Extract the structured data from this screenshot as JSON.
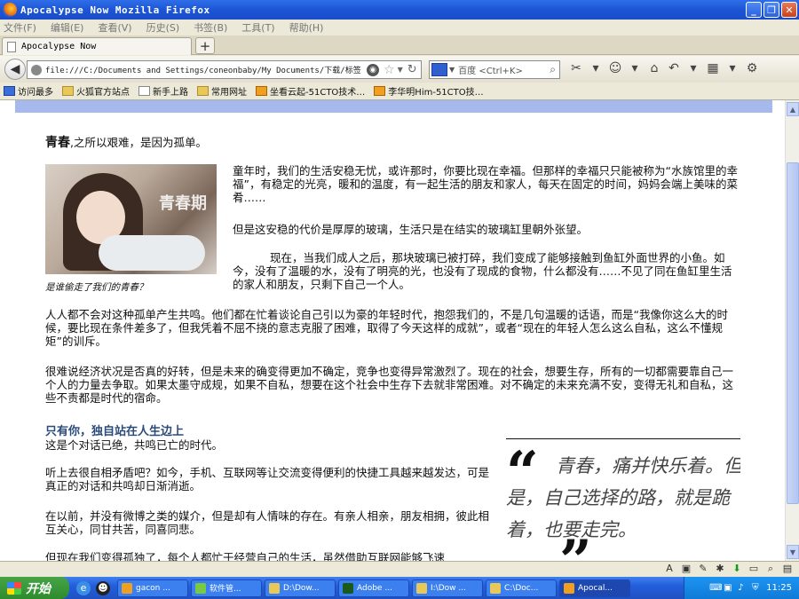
{
  "window": {
    "title": "Apocalypse Now   Mozilla Firefox"
  },
  "menu": [
    "文件(F)",
    "编辑(E)",
    "查看(V)",
    "历史(S)",
    "书签(B)",
    "工具(T)",
    "帮助(H)"
  ],
  "tab": {
    "label": "Apocalypse Now",
    "new_tab": "+"
  },
  "nav": {
    "url": "file:///C:/Documents and Settings/coneonbaby/My Documents/下载/标签",
    "search_placeholder": "百度 <Ctrl+K>"
  },
  "bookmarks": [
    "访问最多",
    "火狐官方站点",
    "新手上路",
    "常用网址",
    "坐看云起-51CTO技术…",
    "李华明Him-51CTO技…"
  ],
  "article": {
    "intro_bold": "青春",
    "intro_rest": ",之所以艰难，是因为孤单。",
    "p1": "童年时，我们的生活安稳无忧，或许那时，你要比现在幸福。但那样的幸福只只能被称为“水族馆里的幸福”，有稳定的光亮，暖和的温度，有一起生活的朋友和家人，每天在固定的时间，妈妈会端上美味的菜肴……",
    "p2": "但是这安稳的代价是厚厚的玻璃，生活只是在结实的玻璃缸里朝外张望。",
    "p3": "现在，当我们成人之后，那块玻璃已被打碎，我们变成了能够接触到鱼缸外面世界的小鱼。如今，没有了温暖的水，没有了明亮的光，也没有了现成的食物，什么都没有……不见了同在鱼缸里生活的家人和朋友，只剩下自己一个人。",
    "image_watermark": "青春期",
    "caption": "是谁偷走了我们的青春？",
    "p4": "人人都不会对这种孤单产生共鸣。他们都在忙着谈论自己引以为豪的年轻时代，抱怨我们的，不是几句温暖的话语，而是“我像你这么大的时候，要比现在条件差多了，但我凭着不屈不挠的意志克服了困难，取得了今天这样的成就”，或者“现在的年轻人怎么这么自私，这么不懂规矩”的训斥。",
    "p5": "很难说经济状况是否真的好转，但是未来的确变得更加不确定，竞争也变得异常激烈了。现在的社会，想要生存，所有的一切都需要靠自己一个人的力量去争取。如果太墨守成规，如果不自私，想要在这个社会中生存下去就非常困难。对不确定的未来充满不安，变得无礼和自私，这些不责都是时代的宿命。",
    "section_title": "只有你，独自站在人生边上",
    "p6": "这是个对话已绝，共鸣已亡的时代。",
    "p7": "听上去很自相矛盾吧？如今，手机、互联网等让交流变得便利的快捷工具越来越发达，可是真正的对话和共鸣却日渐消逝。",
    "p8": "在以前，并没有微博之类的媒介，但是却有人情味的存在。有亲人相亲，朋友相拥，彼此相互关心，同甘共苦，同喜同悲。",
    "p9": "但现在我们变得孤独了，每个人都忙于经营自己的生活，虽然借助互联网能够飞速",
    "quote_open": "“",
    "quote": "青春，痛并快乐着。但是，自己选择的路，就是跪着，也要走完。",
    "quote_close": "”"
  },
  "taskbar": {
    "start": "开始",
    "tasks": [
      "gacon ...",
      "软件管...",
      "D:\\Dow...",
      "Adobe ...",
      "I:\\Dow ...",
      "C:\\Doc...",
      "Apocal..."
    ],
    "clock": "11:25"
  },
  "colors": {
    "titlebar": "#1c55d6",
    "banner": "#a5b9ed",
    "section_heading": "#2a4a7a",
    "taskbar": "#245edb",
    "start_button": "#2e8b2e"
  }
}
